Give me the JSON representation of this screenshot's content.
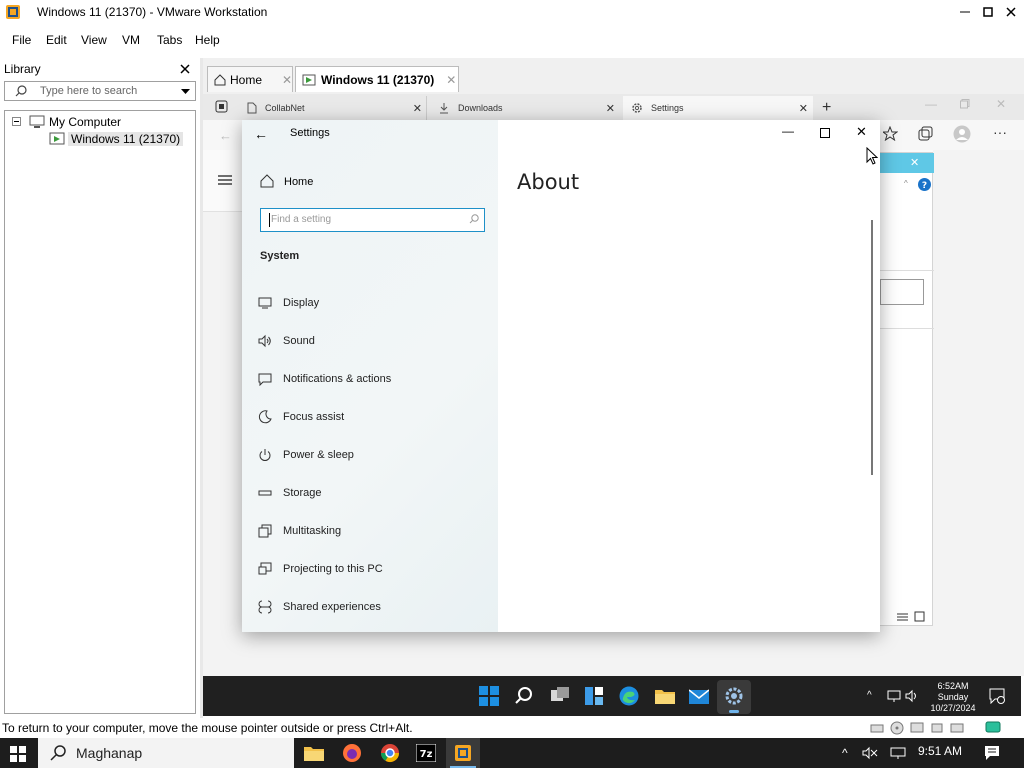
{
  "window": {
    "title": "Windows 11 (21370) - VMware Workstation"
  },
  "menu": [
    "File",
    "Edit",
    "View",
    "VM",
    "Tabs",
    "Help"
  ],
  "library": {
    "title": "Library",
    "search_placeholder": "Type here to search",
    "tree": {
      "root": "My Computer",
      "child": "Windows 11 (21370)"
    }
  },
  "vm_tabs": [
    {
      "label": "Home"
    },
    {
      "label": "Windows 11 (21370)"
    }
  ],
  "browser": {
    "tabs": [
      {
        "label": "CollabNet"
      },
      {
        "label": "Downloads"
      },
      {
        "label": "Settings"
      }
    ]
  },
  "settings": {
    "title": "Settings",
    "home": "Home",
    "search_placeholder": "Find a setting",
    "section": "System",
    "page_heading": "About",
    "nav": [
      {
        "label": "Display",
        "icon": "display-icon"
      },
      {
        "label": "Sound",
        "icon": "sound-icon"
      },
      {
        "label": "Notifications & actions",
        "icon": "notifications-icon"
      },
      {
        "label": "Focus assist",
        "icon": "focus-assist-icon"
      },
      {
        "label": "Power & sleep",
        "icon": "power-icon"
      },
      {
        "label": "Storage",
        "icon": "storage-icon"
      },
      {
        "label": "Multitasking",
        "icon": "multitasking-icon"
      },
      {
        "label": "Projecting to this PC",
        "icon": "projecting-icon"
      },
      {
        "label": "Shared experiences",
        "icon": "shared-experiences-icon"
      }
    ]
  },
  "guest_clock": {
    "time": "6:52AM",
    "day": "Sunday",
    "date": "10/27/2024"
  },
  "status_bar": {
    "text": "To return to your computer, move the mouse pointer outside or press Ctrl+Alt."
  },
  "host_taskbar": {
    "search_text": "Maghanap",
    "time": "9:51 AM"
  },
  "colors": {
    "accent": "#0078d4",
    "taskbar": "#202020",
    "host_taskbar": "#1d1d1d"
  }
}
